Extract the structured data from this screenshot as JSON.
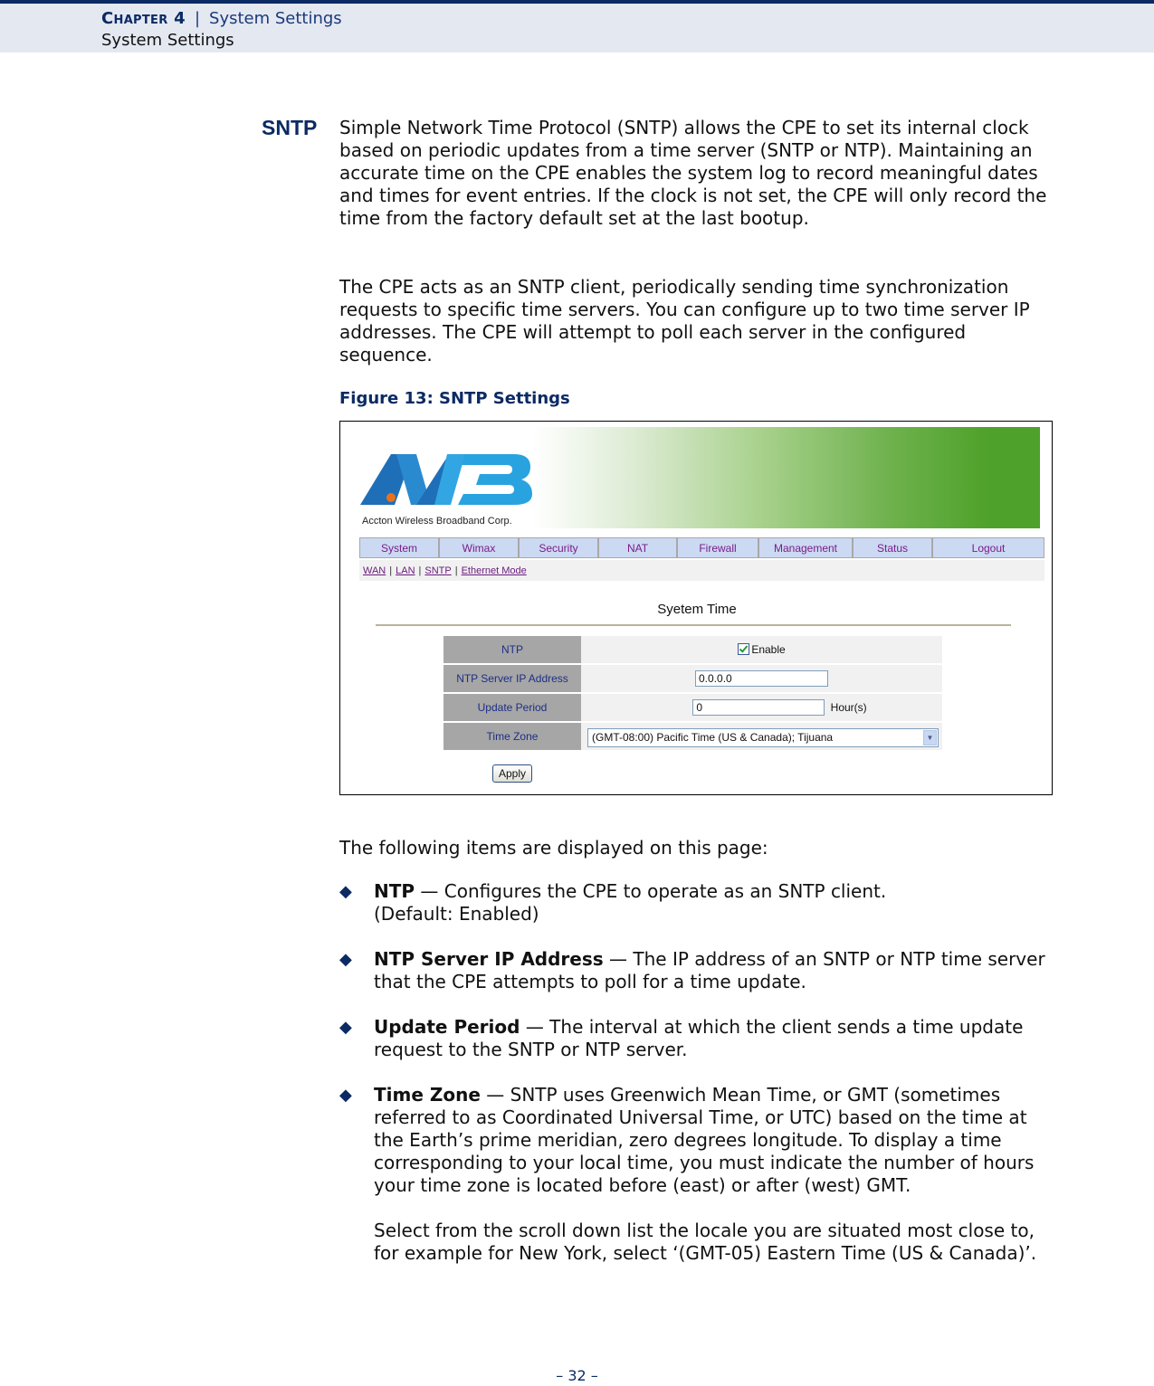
{
  "header": {
    "chapter": "Chapter 4",
    "separator": "|",
    "chapter_title": "System Settings",
    "section": "System Settings"
  },
  "section_label": "SNTP",
  "paragraphs": [
    "Simple Network Time Protocol (SNTP) allows the CPE to set its internal clock based on periodic updates from a time server (SNTP or NTP). Maintaining an accurate time on the CPE enables the system log to record meaningful dates and times for event entries. If the clock is not set, the CPE will only record the time from the factory default set at the last bootup.",
    "The CPE acts as an SNTP client, periodically sending time synchronization requests to specific time servers. You can configure up to two time server IP addresses. The CPE will attempt to poll each server in the configured sequence."
  ],
  "figure": {
    "caption": "Figure 13:  SNTP Settings",
    "logo_text": "Accton Wireless Broadband Corp.",
    "nav": [
      "System",
      "Wimax",
      "Security",
      "NAT",
      "Firewall",
      "Management",
      "Status",
      "Logout"
    ],
    "subnav": [
      "WAN",
      "LAN",
      "SNTP",
      "Ethernet Mode"
    ],
    "panel_title": "Syetem Time",
    "rows": {
      "ntp": {
        "label": "NTP",
        "checkbox_label": "Enable",
        "checked": true
      },
      "server": {
        "label": "NTP Server IP Address",
        "value": "0.0.0.0"
      },
      "period": {
        "label": "Update Period",
        "value": "0",
        "unit": "Hour(s)"
      },
      "timezone": {
        "label": "Time Zone",
        "value": "(GMT-08:00) Pacific Time (US & Canada); Tijuana"
      }
    },
    "apply_label": "Apply",
    "colors": {
      "banner_green": "#4ea12a",
      "nav_bg": "#ccd9f2",
      "nav_text": "#7a1c8a",
      "label_bg": "#a6a6a6"
    }
  },
  "items_intro": "The following items are displayed on this page:",
  "items": [
    {
      "term": "NTP",
      "desc": " — Configures the CPE to operate as an SNTP client. (Default: Enabled)"
    },
    {
      "term": "NTP Server IP Address",
      "desc": " — The IP address of an SNTP or NTP time server that the CPE attempts to poll for a time update."
    },
    {
      "term": "Update Period",
      "desc": " — The interval at which the client sends a time update request to the SNTP or NTP server."
    },
    {
      "term": "Time Zone",
      "desc": " — SNTP uses Greenwich Mean Time, or GMT (sometimes referred to as Coordinated Universal Time, or UTC) based on the time at the Earth’s prime meridian, zero degrees longitude. To display a time corresponding to your local time, you must indicate the number of hours your time zone is located before (east) or after (west) GMT.",
      "extra": "Select from the scroll down list the locale you are situated most close to, for example for New York, select ‘(GMT-05) Eastern Time (US & Canada)’."
    }
  ],
  "page_number": "–  32  –"
}
